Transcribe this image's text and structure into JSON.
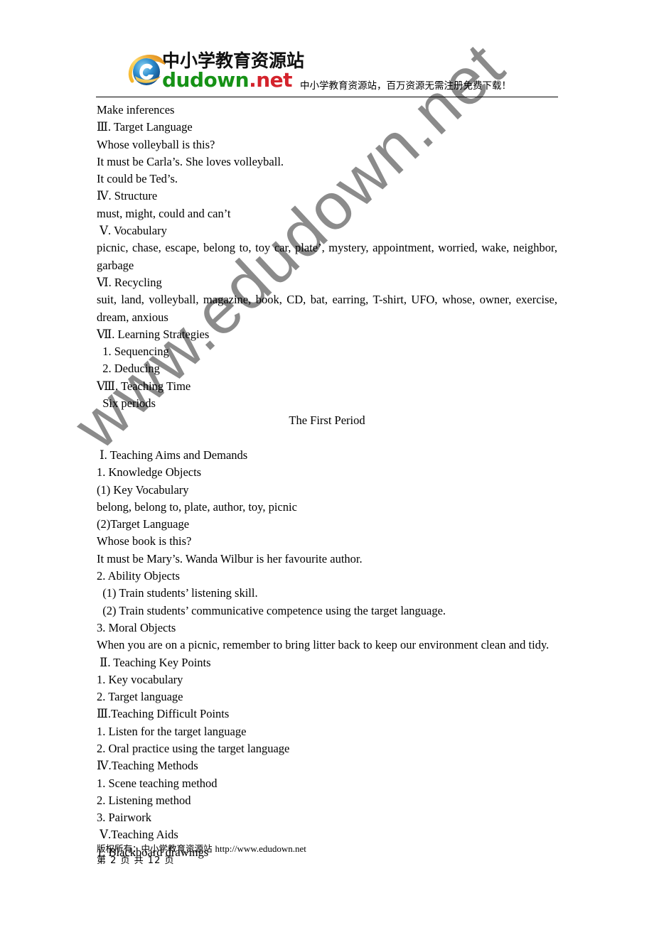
{
  "header": {
    "logo": {
      "icon": "internet-explorer-e-icon",
      "chinese_text": "中小学教育资源站",
      "latin_prefix": "dudown",
      "latin_dot": ".",
      "latin_suffix": "net"
    },
    "tagline": "中小学教育资源站，百万资源无需注册免费下载！"
  },
  "watermark": {
    "text": "www.edudown.net",
    "color": "#828282"
  },
  "body_lines": [
    {
      "text": "Make inferences",
      "align": "left"
    },
    {
      "text": "Ⅲ. Target Language",
      "align": "left"
    },
    {
      "text": "Whose volleyball is this?",
      "align": "left"
    },
    {
      "text": "It must be Carla’s. She loves volleyball.",
      "align": "left"
    },
    {
      "text": "It could be Ted’s.",
      "align": "left"
    },
    {
      "text": "Ⅳ. Structure",
      "align": "left"
    },
    {
      "text": "must, might, could and can’t",
      "align": "left"
    },
    {
      "text": " Ⅴ. Vocabulary",
      "align": "left"
    },
    {
      "text": "picnic, chase, escape, belong to, toy car, plate’, mystery, appointment, worried, wake, neighbor, garbage",
      "align": "justify"
    },
    {
      "text": "Ⅵ. Recycling",
      "align": "left"
    },
    {
      "text": "suit, land, volleyball, magazine, book, CD, bat, earring, T-shirt, UFO, whose, owner, exercise, dream, anxious",
      "align": "justify"
    },
    {
      "text": "Ⅶ. Learning Strategies",
      "align": "left"
    },
    {
      "text": "  1. Sequencing",
      "align": "left"
    },
    {
      "text": "  2. Deducing",
      "align": "left"
    },
    {
      "text": "Ⅷ. Teaching Time",
      "align": "left"
    },
    {
      "text": "  Six periods",
      "align": "left"
    },
    {
      "text": "The First Period",
      "align": "center"
    },
    {
      "text": "",
      "align": "spacer"
    },
    {
      "text": " Ⅰ. Teaching Aims and Demands",
      "align": "left"
    },
    {
      "text": "1. Knowledge Objects",
      "align": "left"
    },
    {
      "text": "(1) Key Vocabulary",
      "align": "left"
    },
    {
      "text": "belong, belong to, plate, author, toy, picnic",
      "align": "left"
    },
    {
      "text": "(2)Target Language",
      "align": "left"
    },
    {
      "text": "Whose book is this?",
      "align": "left"
    },
    {
      "text": "It must be Mary’s. Wanda Wilbur is her favourite author.",
      "align": "left"
    },
    {
      "text": "2. Ability Objects",
      "align": "left"
    },
    {
      "text": "  (1) Train students’ listening skill.",
      "align": "left"
    },
    {
      "text": "  (2) Train students’ communicative competence using the target language.",
      "align": "left"
    },
    {
      "text": "3. Moral Objects",
      "align": "left"
    },
    {
      "text": "When you are on a picnic, remember to bring litter back to keep our environment clean and tidy.",
      "align": "left"
    },
    {
      "text": " Ⅱ. Teaching Key Points",
      "align": "left"
    },
    {
      "text": "1. Key vocabulary",
      "align": "left"
    },
    {
      "text": "2. Target language",
      "align": "left"
    },
    {
      "text": "Ⅲ.Teaching Difficult Points",
      "align": "left"
    },
    {
      "text": "1. Listen for the target language",
      "align": "left"
    },
    {
      "text": "2. Oral practice using the target language",
      "align": "left"
    },
    {
      "text": "Ⅳ.Teaching Methods",
      "align": "left"
    },
    {
      "text": "1. Scene teaching method",
      "align": "left"
    },
    {
      "text": "2. Listening method",
      "align": "left"
    },
    {
      "text": "3. Pairwork",
      "align": "left"
    },
    {
      "text": " Ⅴ.Teaching Aids",
      "align": "left"
    },
    {
      "text": "1. Blackboard drawings",
      "align": "left"
    }
  ],
  "footer": {
    "copyright_cn": "版权所有：中小学教育资源站 ",
    "copyright_url": "http://www.edudown.net",
    "page_indicator": "第 2 页 共 12 页"
  }
}
